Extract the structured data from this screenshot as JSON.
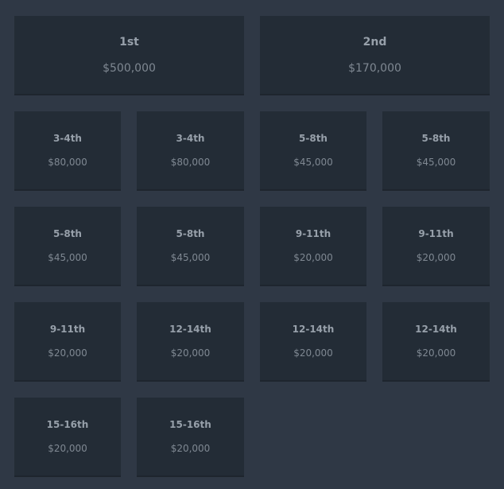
{
  "prizes": [
    {
      "place": "1st",
      "amount": "$500,000"
    },
    {
      "place": "2nd",
      "amount": "$170,000"
    },
    {
      "place": "3-4th",
      "amount": "$80,000"
    },
    {
      "place": "3-4th",
      "amount": "$80,000"
    },
    {
      "place": "5-8th",
      "amount": "$45,000"
    },
    {
      "place": "5-8th",
      "amount": "$45,000"
    },
    {
      "place": "5-8th",
      "amount": "$45,000"
    },
    {
      "place": "5-8th",
      "amount": "$45,000"
    },
    {
      "place": "9-11th",
      "amount": "$20,000"
    },
    {
      "place": "9-11th",
      "amount": "$20,000"
    },
    {
      "place": "9-11th",
      "amount": "$20,000"
    },
    {
      "place": "12-14th",
      "amount": "$20,000"
    },
    {
      "place": "12-14th",
      "amount": "$20,000"
    },
    {
      "place": "12-14th",
      "amount": "$20,000"
    },
    {
      "place": "15-16th",
      "amount": "$20,000"
    },
    {
      "place": "15-16th",
      "amount": "$20,000"
    }
  ]
}
